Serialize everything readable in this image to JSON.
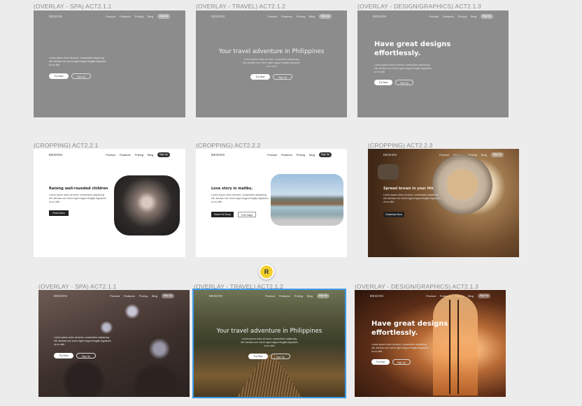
{
  "canvas": {
    "collaborator_initial": "R",
    "frames": [
      {
        "label": "(OVERLAY - SPA) ACT2.1.1",
        "style": "overlay-spa-gray",
        "title": "",
        "subtitle": "Lorem ipsum dolor sit amet, consectetur adipiscing elit. Aenean nec lorem eget magna fringilla dignissim ut eu nibh",
        "btn1": "Try Now",
        "btn2": "Sign Up"
      },
      {
        "label": "(OVERLAY - TRAVEL) ACT2.1.2",
        "style": "overlay-travel-gray",
        "title": "Your travel adventure in Philippines",
        "subtitle": "Lorem ipsum dolor sit amet, consectetur adipiscing elit. Aenean nec lorem eget magna fringilla dignissim ut eu nibh",
        "btn1": "Try Now",
        "btn2": "Sign Up"
      },
      {
        "label": "(OVERLAY - DESIGN/GRAPHICS) ACT2.1.3",
        "style": "overlay-design-gray",
        "title": "Have great designs effortlessly.",
        "subtitle": "Lorem ipsum dolor sit amet, consectetur adipiscing elit. Aenean nec lorem eget magna fringilla dignissim ut eu nibh",
        "btn1": "Try Now",
        "btn2": "Sign Up"
      },
      {
        "label": "(CROPPING) ACT2.2.1",
        "style": "crop-children",
        "title": "Raising well-rounded children",
        "subtitle": "Lorem ipsum dolor sit amet, consectetur adipiscing elit. Aenean nec lorem eget magna fringilla dignissim ut eu nibh",
        "btn1": "Read More",
        "btn2": ""
      },
      {
        "label": "(CROPPING) ACT2.2.2",
        "style": "crop-malibu",
        "title": "Love story in malibu.",
        "subtitle": "Lorem ipsum dolor sit amet, consectetur adipiscing elit. Aenean nec lorem eget magna fringilla dignissim ut eu nibh",
        "btn1": "Read Full Story",
        "btn2": "Find Stays"
      },
      {
        "label": "(CROPPING) ACT2.2.3",
        "style": "crop-coffee",
        "title": "Spread brown in your life",
        "subtitle": "Lorem ipsum dolor sit amet, consectetur adipiscing elit. Aenean nec lorem eget magna fringilla dignissim ut eu nibh",
        "btn1": "Download Now",
        "btn2": ""
      },
      {
        "label": "(OVERLAY - SPA) ACT2.1.1",
        "style": "overlay-spa-photo",
        "title": "",
        "subtitle": "Lorem ipsum dolor sit amet, consectetur adipiscing elit. Aenean nec lorem eget magna fringilla dignissim ut eu nibh",
        "btn1": "Try Now",
        "btn2": "Sign Up"
      },
      {
        "label": "(OVERLAY - TRAVEL) ACT2.1.2",
        "style": "overlay-travel-photo",
        "title": "Your travel adventure in Philippines",
        "subtitle": "Lorem ipsum dolor sit amet, consectetur adipiscing elit. Aenean nec lorem eget magna fringilla dignissim ut eu nibh",
        "btn1": "Try Now",
        "btn2": "Sign Up"
      },
      {
        "label": "(OVERLAY - DESIGN/GRAPHICS) ACT2.1.3",
        "style": "overlay-design-photo",
        "title": "Have great designs effortlessly.",
        "subtitle": "Lorem ipsum dolor sit amet, consectetur adipiscing elit. Aenean nec lorem eget magna fringilla dignissim ut eu nibh",
        "btn1": "Try Now",
        "btn2": "Sign Up"
      }
    ]
  },
  "nav": {
    "logo": "DESIGN",
    "links": [
      "Product",
      "Features",
      "Pricing",
      "Blog"
    ],
    "signup": "Sign Up"
  },
  "selected_frame_index": 7,
  "colors": {
    "selection": "#3d9bea",
    "avatar": "#f4cf2c",
    "gray_frame": "#8c8c8c",
    "canvas": "#ececec"
  }
}
